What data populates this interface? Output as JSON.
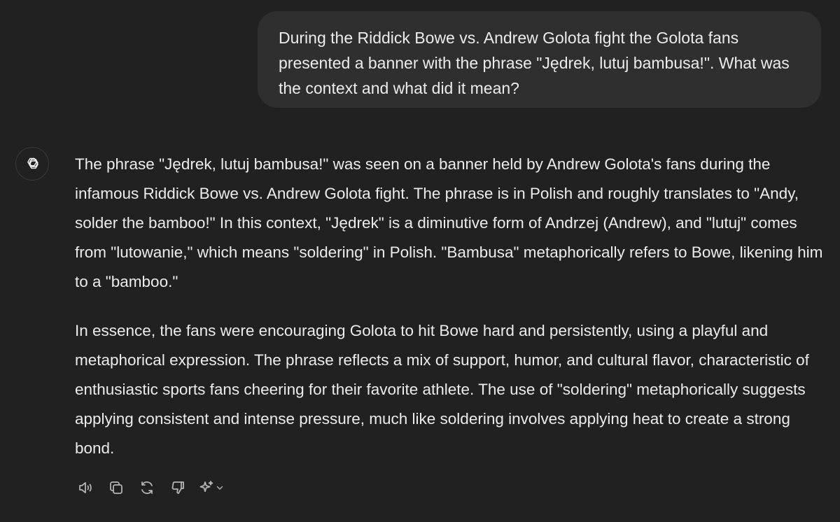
{
  "user_message": {
    "text": "During the Riddick Bowe vs. Andrew Golota fight the Golota fans presented a banner with the phrase \"Jędrek, lutuj bambusa!\". What was the context and what did it mean?"
  },
  "assistant": {
    "avatar_icon": "openai-logo-icon",
    "paragraphs": [
      "The phrase \"Jędrek, lutuj bambusa!\" was seen on a banner held by Andrew Golota's fans during the infamous Riddick Bowe vs. Andrew Golota fight. The phrase is in Polish and roughly translates to \"Andy, solder the bamboo!\" In this context, \"Jędrek\" is a diminutive form of Andrzej (Andrew), and \"lutuj\" comes from \"lutowanie,\" which means \"soldering\" in Polish. \"Bambusa\" metaphorically refers to Bowe, likening him to a \"bamboo.\"",
      "In essence, the fans were encouraging Golota to hit Bowe hard and persistently, using a playful and metaphorical expression. The phrase reflects a mix of support, humor, and cultural flavor, characteristic of enthusiastic sports fans cheering for their favorite athlete. The use of \"soldering\" metaphorically suggests applying consistent and intense pressure, much like soldering involves applying heat to create a strong bond."
    ]
  },
  "actions": [
    {
      "icon": "speaker-icon"
    },
    {
      "icon": "copy-icon"
    },
    {
      "icon": "regenerate-icon"
    },
    {
      "icon": "thumbs-down-icon"
    },
    {
      "icon": "sparkle-icon"
    }
  ],
  "colors": {
    "background": "#212121",
    "user_bubble": "#2f2f2f",
    "text": "#ececec",
    "icon": "#b4b4b4"
  }
}
